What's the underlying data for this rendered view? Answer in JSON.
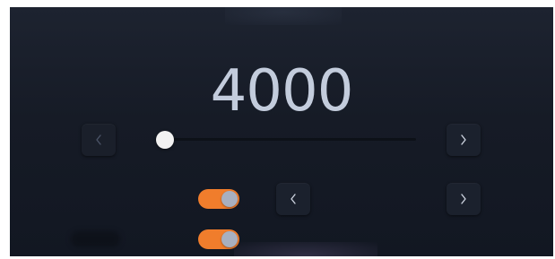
{
  "display": {
    "value": "4000"
  },
  "slider": {
    "value_fraction": 0.0
  },
  "toggles": [
    {
      "state": "on"
    },
    {
      "state": "on"
    }
  ],
  "icons": {
    "prev": "chevron-left-icon",
    "next": "chevron-right-icon"
  },
  "colors": {
    "accent": "#f07d2c",
    "background": "#161b26",
    "value_text": "#c3ccdc",
    "knob": "#a8b0c0"
  }
}
